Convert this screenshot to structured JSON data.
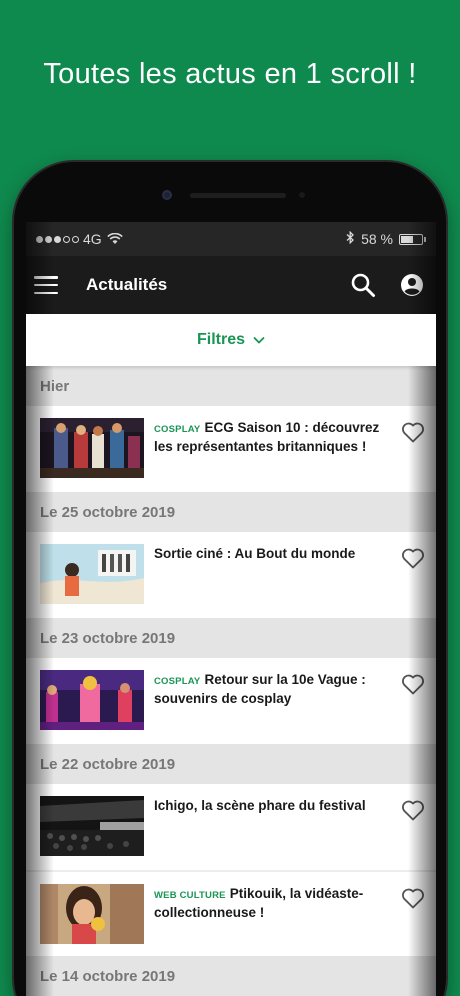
{
  "promo_text": "Toutes les actus en 1 scroll !",
  "status_bar": {
    "network": "4G",
    "battery": "58 %",
    "battery_level": 0.58
  },
  "app_bar": {
    "title": "Actualités",
    "icons": [
      "menu-icon",
      "search-icon",
      "account-icon"
    ]
  },
  "filters": {
    "label": "Filtres"
  },
  "colors": {
    "brand_green": "#0f8a4e",
    "tag_green": "#1a9553",
    "appbar": "#1b1b1b"
  },
  "sections": [
    {
      "date": "Hier",
      "articles": [
        {
          "tag": "COSPLAY",
          "title": "ECG Saison 10 : découvrez les représentantes britanniques !"
        }
      ]
    },
    {
      "date": "Le 25 octobre 2019",
      "articles": [
        {
          "tag": "",
          "title": "Sortie ciné : Au Bout du monde"
        }
      ]
    },
    {
      "date": "Le 23 octobre 2019",
      "articles": [
        {
          "tag": "COSPLAY",
          "title": "Retour sur la 10e Vague : souvenirs de cosplay"
        }
      ]
    },
    {
      "date": "Le 22 octobre 2019",
      "articles": [
        {
          "tag": "",
          "title": "Ichigo, la scène phare du festival"
        },
        {
          "tag": "WEB CULTURE",
          "title": "Ptikouik, la vidéaste-collectionneuse !"
        }
      ]
    },
    {
      "date": "Le 14 octobre 2019",
      "articles": []
    }
  ]
}
